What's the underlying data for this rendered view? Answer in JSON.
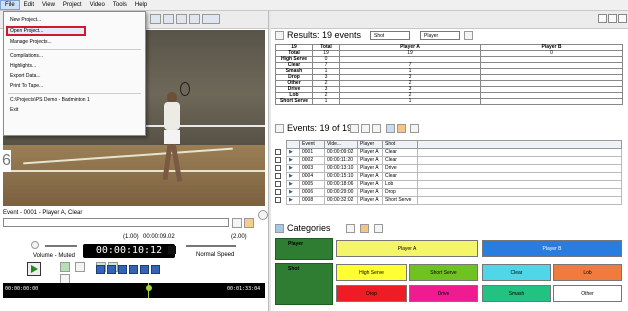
{
  "menubar": {
    "items": [
      "File",
      "Edit",
      "View",
      "Project",
      "Video",
      "Tools",
      "Help"
    ]
  },
  "file_menu": {
    "items": [
      "New Project...",
      "Open Project...",
      "Manage Projects...",
      "Compilations...",
      "Highlights...",
      "Export Data...",
      "Print To Tape...",
      "C:\\Projects\\PS Demo - Badminton 1",
      "Exit"
    ]
  },
  "video": {
    "event_label": "Event - 0001 - Player A, Clear",
    "rate_left": "(1.00)",
    "position": "00:00:09.02",
    "rate_right": "(2.00)",
    "timecode": "00:00:10:12",
    "volume_label": "Volume - Muted",
    "speed_label": "Normal Speed",
    "timeline_start": "00:00:00:00",
    "timeline_end": "00:01:33:04"
  },
  "page_number": "6",
  "results": {
    "title": "Results: 19 events",
    "filter1": "Shot",
    "filter2": "Player",
    "columns": [
      "19",
      "Total",
      "Player A",
      "Player B"
    ],
    "rows": [
      {
        "label": "Total",
        "total": "19",
        "a": "19",
        "b": "0"
      },
      {
        "label": "High Serve",
        "total": "0",
        "a": "",
        "b": ""
      },
      {
        "label": "Clear",
        "total": "7",
        "a": "7",
        "b": ""
      },
      {
        "label": "Smash",
        "total": "1",
        "a": "1",
        "b": ""
      },
      {
        "label": "Drop",
        "total": "3",
        "a": "3",
        "b": ""
      },
      {
        "label": "Other",
        "total": "2",
        "a": "2",
        "b": ""
      },
      {
        "label": "Drive",
        "total": "3",
        "a": "3",
        "b": ""
      },
      {
        "label": "Lob",
        "total": "2",
        "a": "2",
        "b": ""
      },
      {
        "label": "Short Serve",
        "total": "1",
        "a": "1",
        "b": ""
      }
    ]
  },
  "events": {
    "title": "Events: 19 of 19",
    "columns": [
      "Event",
      "Vide...",
      "Player",
      "Shot"
    ],
    "rows": [
      {
        "event": "0001",
        "video": "00:00:09:02",
        "player": "Player A",
        "shot": "Clear"
      },
      {
        "event": "0002",
        "video": "00:00:11:20",
        "player": "Player A",
        "shot": "Clear"
      },
      {
        "event": "0003",
        "video": "00:00:13:10",
        "player": "Player A",
        "shot": "Drive"
      },
      {
        "event": "0004",
        "video": "00:00:15:10",
        "player": "Player A",
        "shot": "Clear"
      },
      {
        "event": "0005",
        "video": "00:00:18:06",
        "player": "Player A",
        "shot": "Lob"
      },
      {
        "event": "0006",
        "video": "00:00:29:00",
        "player": "Player A",
        "shot": "Drop"
      },
      {
        "event": "0008",
        "video": "00:00:32:02",
        "player": "Player A",
        "shot": "Short Serve"
      }
    ]
  },
  "categories": {
    "title": "Categories",
    "groups": [
      {
        "name": "Player",
        "buttons": [
          {
            "label": "Player A",
            "color": "#f5f56a"
          },
          {
            "label": "Player B",
            "color": "#2a7de0"
          }
        ]
      },
      {
        "name": "Shot",
        "buttons": [
          {
            "label": "High Serve",
            "color": "#ffff33"
          },
          {
            "label": "Short Serve",
            "color": "#6fc21f"
          },
          {
            "label": "Clear",
            "color": "#4fd7e8"
          },
          {
            "label": "Lob",
            "color": "#f07b3c"
          },
          {
            "label": "Drop",
            "color": "#ee1c24"
          },
          {
            "label": "Drive",
            "color": "#ee1c8f"
          },
          {
            "label": "Smash",
            "color": "#22c283"
          },
          {
            "label": "Other",
            "color": "#ffffff"
          }
        ]
      }
    ]
  }
}
